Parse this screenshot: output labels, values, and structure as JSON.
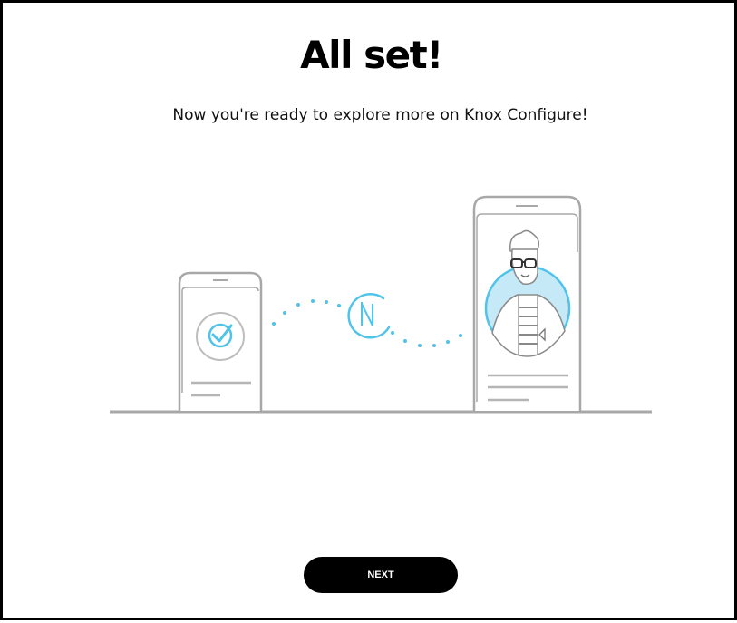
{
  "screen": {
    "title": "All set!",
    "subtitle": "Now you're ready to explore more on Knox Configure!",
    "next_button_label": "NEXT"
  },
  "illustration": {
    "subject": "two phones linked by NFC",
    "icons": [
      "phone-check-icon",
      "nfc-icon",
      "phone-profile-icon"
    ],
    "accent_color": "#4fc3ea",
    "accent_fill": "#c6e9f7",
    "line_color": "#a8a8a8"
  }
}
